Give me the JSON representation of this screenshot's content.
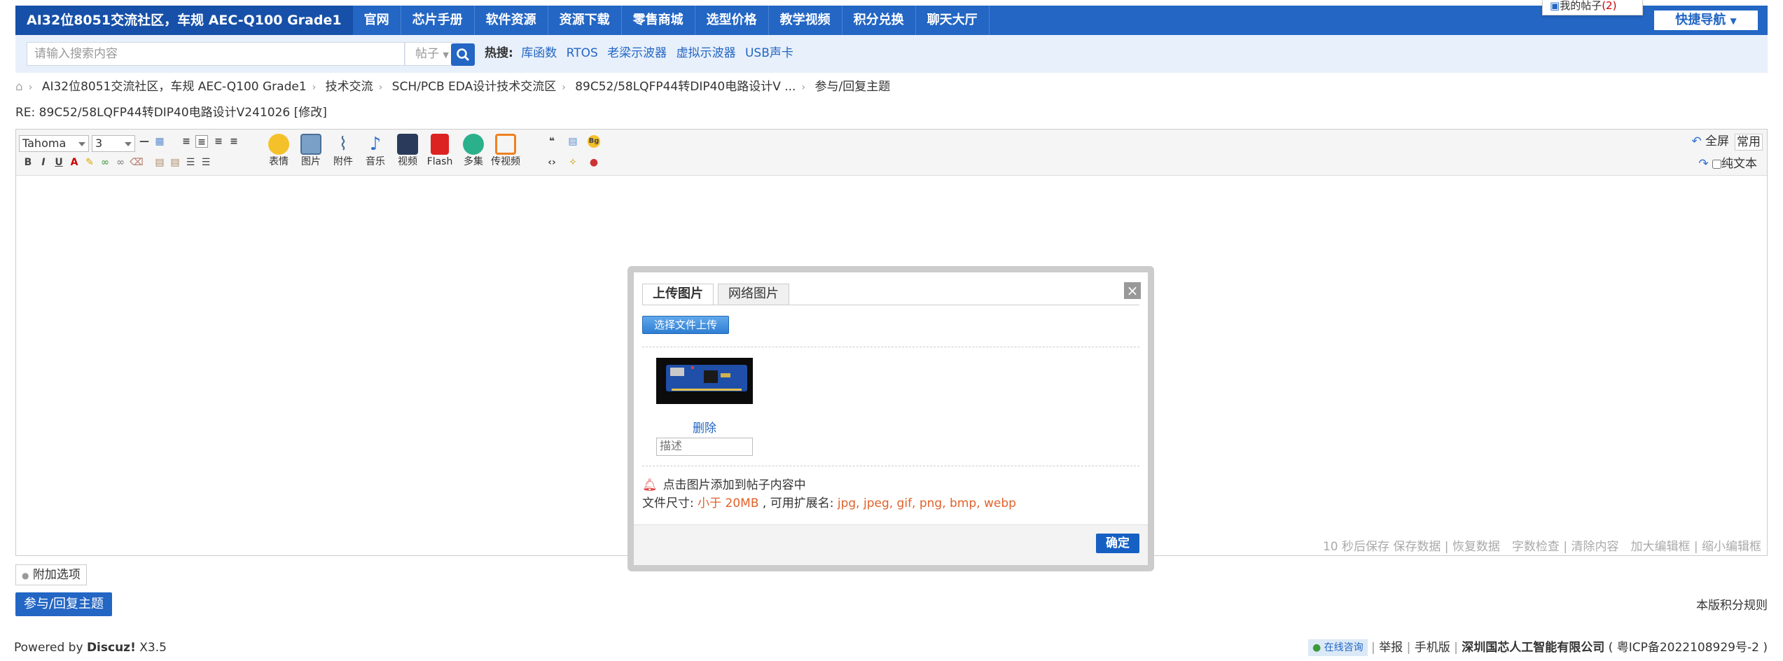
{
  "topnav": {
    "brand": "AI32位8051交流社区，车规 AEC-Q100 Grade1",
    "items": [
      "官网",
      "芯片手册",
      "软件资源",
      "资源下载",
      "零售商城",
      "选型价格",
      "教学视频",
      "积分兑换",
      "聊天大厅"
    ],
    "quick_nav": "快捷导航",
    "my_posts": "我的帖子",
    "my_posts_count": "(2)"
  },
  "search": {
    "placeholder": "请输入搜索内容",
    "type": "帖子",
    "hot_label": "热搜:",
    "hot_items": [
      "库函数",
      "RTOS",
      "老梁示波器",
      "虚拟示波器",
      "USB声卡"
    ]
  },
  "breadcrumb": [
    "AI32位8051交流社区，车规 AEC-Q100 Grade1",
    "技术交流",
    "SCH/PCB EDA设计技术交流区",
    "89C52/58LQFP44转DIP40电路设计V ...",
    "参与/回复主题"
  ],
  "subject": "RE: 89C52/58LQFP44转DIP40电路设计V241026 [修改]",
  "editor": {
    "font": "Tahoma",
    "size": "3",
    "tools": [
      "表情",
      "图片",
      "附件",
      "音乐",
      "视频",
      "Flash",
      "多集",
      "传视频"
    ],
    "fullscreen": "全屏",
    "common": "常用",
    "plaintext": "纯文本",
    "status": "10 秒后保存 保存数据 | 恢复数据　字数检查 | 清除内容　加大编辑框 | 缩小编辑框"
  },
  "dialog": {
    "tabs": [
      "上传图片",
      "网络图片"
    ],
    "upload_button": "选择文件上传",
    "delete": "删除",
    "desc_placeholder": "描述",
    "tip": "点击图片添加到帖子内容中",
    "filesize_label": "文件尺寸:",
    "filesize_value": "小于 20MB",
    "ext_label": ", 可用扩展名:",
    "ext_value": "jpg, jpeg, gif, png, bmp, webp",
    "confirm": "确定"
  },
  "attach_option": "附加选项",
  "reply_button": "参与/回复主题",
  "credit_rule": "本版积分规则",
  "footer": {
    "powered_prefix": "Powered by",
    "powered_name": "Discuz!",
    "powered_ver": "X3.5",
    "online": "在线咨询",
    "report": "举报",
    "mobile": "手机版",
    "company": "深圳国芯人工智能有限公司",
    "icp": "( 粤ICP备2022108929号-2 )"
  },
  "colors": {
    "nav_bg": "#2366c4",
    "accent_red": "#e0622a",
    "search_bg": "#e8f0fb"
  }
}
